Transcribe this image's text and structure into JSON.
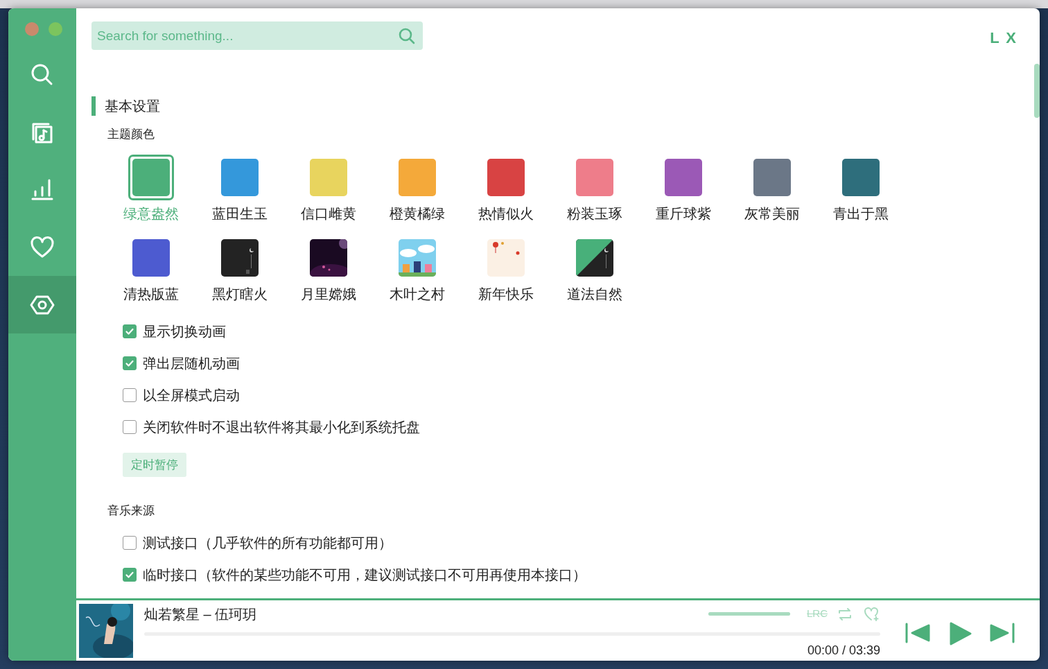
{
  "window": {
    "traffic_lights": [
      {
        "color": "#c98a6c"
      },
      {
        "color": "#7cc45e"
      }
    ]
  },
  "sidebar": {
    "items": [
      {
        "selected": false
      },
      {
        "selected": false
      },
      {
        "selected": false
      },
      {
        "selected": false
      },
      {
        "selected": true
      }
    ]
  },
  "search": {
    "placeholder": "Search for something..."
  },
  "corner_label": "L X",
  "basic_settings": {
    "title": "基本设置",
    "theme_heading": "主题颜色",
    "themes": [
      {
        "label": "绿意盎然",
        "kind": "color",
        "color": "#4caf7a",
        "selected": true
      },
      {
        "label": "蓝田生玉",
        "kind": "color",
        "color": "#3498db",
        "selected": false
      },
      {
        "label": "信口雌黄",
        "kind": "color",
        "color": "#e8d45e",
        "selected": false
      },
      {
        "label": "橙黄橘绿",
        "kind": "color",
        "color": "#f4a93a",
        "selected": false
      },
      {
        "label": "热情似火",
        "kind": "color",
        "color": "#d84343",
        "selected": false
      },
      {
        "label": "粉装玉琢",
        "kind": "color",
        "color": "#ee7d8a",
        "selected": false
      },
      {
        "label": "重斤球紫",
        "kind": "color",
        "color": "#9b59b6",
        "selected": false
      },
      {
        "label": "灰常美丽",
        "kind": "color",
        "color": "#6b7787",
        "selected": false
      },
      {
        "label": "青出于黑",
        "kind": "color",
        "color": "#2e6e7c",
        "selected": false
      },
      {
        "label": "清热版蓝",
        "kind": "color",
        "color": "#4d5bd0",
        "selected": false
      },
      {
        "label": "黑灯瞎火",
        "kind": "picture",
        "selected": false
      },
      {
        "label": "月里嫦娥",
        "kind": "picture",
        "selected": false
      },
      {
        "label": "木叶之村",
        "kind": "picture",
        "selected": false
      },
      {
        "label": "新年快乐",
        "kind": "picture",
        "selected": false
      },
      {
        "label": "道法自然",
        "kind": "picture",
        "selected": false
      }
    ],
    "options": [
      {
        "label": "显示切换动画",
        "checked": true
      },
      {
        "label": "弹出层随机动画",
        "checked": true
      },
      {
        "label": "以全屏模式启动",
        "checked": false
      },
      {
        "label": "关闭软件时不退出软件将其最小化到系统托盘",
        "checked": false
      }
    ],
    "timer_button": "定时暂停"
  },
  "music_source": {
    "title": "音乐来源",
    "options": [
      {
        "label": "测试接口（几乎软件的所有功能都可用）",
        "checked": false
      },
      {
        "label": "临时接口（软件的某些功能不可用，建议测试接口不可用再使用本接口）",
        "checked": true
      }
    ]
  },
  "player": {
    "title": "灿若繁星 – 伍珂玥",
    "volume": {
      "level": 1.0
    },
    "lyrics_button": {
      "label": "LRC",
      "on": false
    },
    "progress": {
      "level": 0.0
    },
    "time": "00:00 / 03:39"
  }
}
